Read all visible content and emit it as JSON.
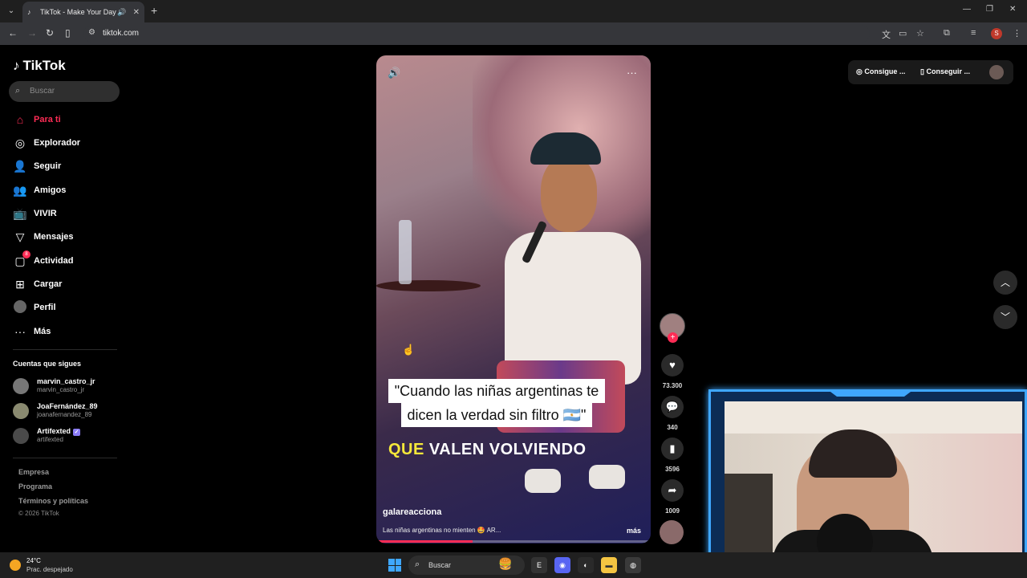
{
  "browser": {
    "tab_title": "TikTok - Make Your Day",
    "url": "tiktok.com",
    "profile_initial": "S"
  },
  "tiktok": {
    "brand": "TikTok",
    "search_placeholder": "Buscar",
    "nav": [
      {
        "label": "Para ti",
        "icon": "home-icon",
        "active": true
      },
      {
        "label": "Explorador",
        "icon": "compass-icon"
      },
      {
        "label": "Seguir",
        "icon": "user-follow-icon"
      },
      {
        "label": "Amigos",
        "icon": "friends-icon"
      },
      {
        "label": "VIVIR",
        "icon": "live-icon"
      },
      {
        "label": "Mensajes",
        "icon": "messages-icon"
      },
      {
        "label": "Actividad",
        "icon": "activity-icon",
        "badge": "8"
      },
      {
        "label": "Cargar",
        "icon": "upload-icon"
      },
      {
        "label": "Perfil",
        "icon": "profile-avatar"
      },
      {
        "label": "Más",
        "icon": "more-icon"
      }
    ],
    "following_title": "Cuentas que sigues",
    "following": [
      {
        "name": "marvin_castro_jr",
        "handle": "marvin_castro_jr"
      },
      {
        "name": "JoaFernández_89",
        "handle": "joanafernandez_89"
      },
      {
        "name": "Artifexted",
        "handle": "artifexted",
        "verified": true
      }
    ],
    "footer": [
      "Empresa",
      "Programa",
      "Términos y políticas"
    ],
    "copyright": "© 2026 TikTok",
    "top_buttons": [
      "Consigue ...",
      "Conseguir ..."
    ]
  },
  "video": {
    "caption_line1": "\"Cuando las niñas argentinas te",
    "caption_line2": "dicen la verdad sin filtro 🇦🇷\"",
    "overlay_highlight": "QUE",
    "overlay_rest": "VALEN VOLVIENDO",
    "author": "galareacciona",
    "description": "Las niñas argentinas no mienten 🤩 AR...",
    "more_label": "más",
    "progress": 0.35,
    "likes": "73.300",
    "comments": "340",
    "saves": "3596",
    "shares": "1009"
  },
  "taskbar": {
    "temperature": "24°C",
    "condition": "Prac. despejado",
    "search_placeholder": "Buscar"
  }
}
